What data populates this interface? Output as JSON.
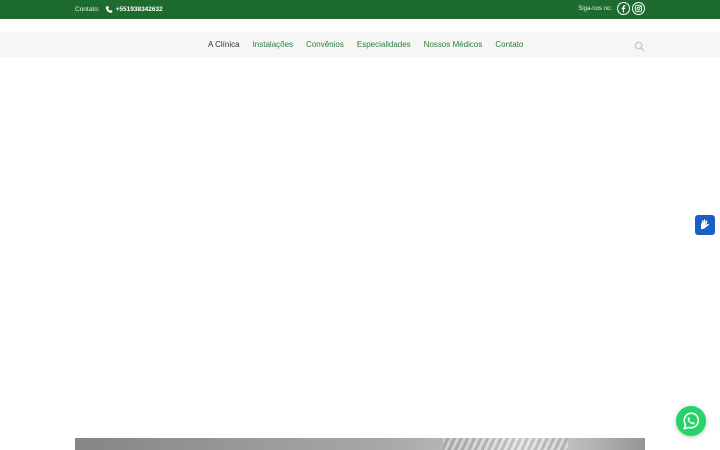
{
  "topbar": {
    "contact_label": "Contato:",
    "phone_icon": "phone-handset-icon",
    "phone_number": "+551938342632",
    "social_label": "Siga-nos no:",
    "social_links": [
      {
        "name": "facebook",
        "icon": "facebook-icon"
      },
      {
        "name": "instagram",
        "icon": "instagram-icon"
      }
    ],
    "background_color": "#1e6b2f"
  },
  "nav": {
    "items": [
      {
        "label": "A Clínica",
        "active": true
      },
      {
        "label": "Instalações",
        "active": false
      },
      {
        "label": "Convênios",
        "active": false
      },
      {
        "label": "Especialidades",
        "active": false
      },
      {
        "label": "Nossos Médicos",
        "active": false
      },
      {
        "label": "Contato",
        "active": false
      }
    ],
    "search_icon": "search-icon",
    "link_color": "#2d7a3e",
    "active_color": "#333333"
  },
  "widgets": {
    "accessibility_icon": "sign-language-hands-icon",
    "accessibility_color": "#1a5fc4",
    "whatsapp_icon": "whatsapp-icon",
    "whatsapp_color": "#25d366"
  }
}
